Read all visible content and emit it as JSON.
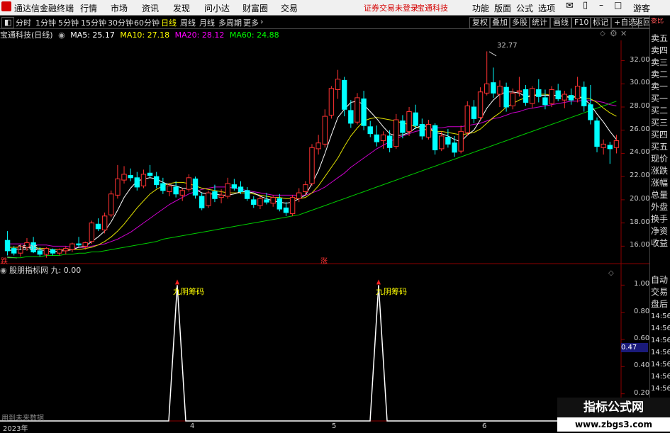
{
  "menubar": {
    "app_title": "通达信金融终端",
    "menus": [
      "行情",
      "市场",
      "资讯",
      "发现",
      "问小达",
      "财富圈",
      "交易"
    ],
    "status_login": "证券交易未登录",
    "status_stock": "宝通科技",
    "right_menus": [
      "功能",
      "版面",
      "公式",
      "选项"
    ],
    "guest": "游客"
  },
  "toolbar": {
    "periods": [
      "分时",
      "1分钟",
      "5分钟",
      "15分钟",
      "30分钟",
      "60分钟",
      "日线",
      "周线",
      "月线",
      "多周期",
      "更多"
    ],
    "active_period": "日线",
    "right_buttons": [
      "复权",
      "叠加",
      "多股",
      "统计",
      "画线",
      "F10",
      "标记",
      "+自选",
      "返回"
    ]
  },
  "chart_header": {
    "stock_title": "宝通科技(日线)",
    "ma5": "MA5: 25.17",
    "ma10": "MA10: 27.18",
    "ma20": "MA20: 28.12",
    "ma60": "MA60: 24.88",
    "colors": {
      "ma5": "#ffffff",
      "ma10": "#ffff00",
      "ma20": "#ff00ff",
      "ma60": "#00ff00"
    }
  },
  "price_axis": [
    "32.00",
    "30.00",
    "28.00",
    "26.00",
    "24.00",
    "22.00",
    "20.00",
    "18.00",
    "16.00"
  ],
  "annotations": {
    "high": "32.77",
    "low": "15.05",
    "rise_mark": "涨",
    "fall_mark": "跌"
  },
  "indicator": {
    "name": "股朋指标网",
    "value_label": "九: 0.00",
    "axis": [
      "1.00",
      "0.80",
      "0.60",
      "0.40",
      "0.20"
    ],
    "current_value": "0.47",
    "signal_text": "九阴筹码",
    "footer": "用到未来数据"
  },
  "time_axis": [
    "2023年",
    "4",
    "5",
    "6"
  ],
  "side_panel": {
    "top": "委比",
    "items": [
      "卖五",
      "卖四",
      "卖三",
      "卖二",
      "卖一",
      "买一",
      "买二",
      "买三",
      "买四",
      "买五",
      "现价",
      "涨跌",
      "涨幅",
      "总量",
      "外盘",
      "换手",
      "净资",
      "收益"
    ],
    "lower": [
      "自动",
      "交易",
      "盘后",
      "14:56",
      "14:56",
      "14:56",
      "14:56",
      "14:56",
      "14:56",
      "14:56",
      "14:56"
    ]
  },
  "watermark": {
    "line1": "指标公式网",
    "line2": "www.zbgs3.com"
  },
  "chart_data": {
    "type": "candlestick",
    "ylim": [
      14.8,
      33.5
    ],
    "candles": [
      [
        16.5,
        17.3,
        15.2,
        15.6
      ],
      [
        15.8,
        16.0,
        15.2,
        15.4
      ],
      [
        15.4,
        16.2,
        15.1,
        16.0
      ],
      [
        15.9,
        16.7,
        15.6,
        16.3
      ],
      [
        16.3,
        16.8,
        15.4,
        15.5
      ],
      [
        15.6,
        15.9,
        15.1,
        15.3
      ],
      [
        15.3,
        15.9,
        15.0,
        15.8
      ],
      [
        15.7,
        15.8,
        15.2,
        15.4
      ],
      [
        15.4,
        15.8,
        15.2,
        15.7
      ],
      [
        15.6,
        16.0,
        15.3,
        15.8
      ],
      [
        15.7,
        16.3,
        15.5,
        16.2
      ],
      [
        16.2,
        16.8,
        15.9,
        16.1
      ],
      [
        16.0,
        16.4,
        15.7,
        16.3
      ],
      [
        16.4,
        18.2,
        16.2,
        18.0
      ],
      [
        17.9,
        18.4,
        17.3,
        17.5
      ],
      [
        17.4,
        18.9,
        17.1,
        18.6
      ],
      [
        18.7,
        20.8,
        18.5,
        20.5
      ],
      [
        20.4,
        23.0,
        20.1,
        21.8
      ],
      [
        21.7,
        22.9,
        21.4,
        22.2
      ],
      [
        22.1,
        22.7,
        21.6,
        21.9
      ],
      [
        21.9,
        22.4,
        20.8,
        21.1
      ],
      [
        21.2,
        22.6,
        21.0,
        22.2
      ],
      [
        22.3,
        23.0,
        21.9,
        22.1
      ],
      [
        22.0,
        22.4,
        21.0,
        21.3
      ],
      [
        21.4,
        21.9,
        20.5,
        20.8
      ],
      [
        20.7,
        21.4,
        20.3,
        21.2
      ],
      [
        21.1,
        21.6,
        20.2,
        20.5
      ],
      [
        20.4,
        21.0,
        19.9,
        20.8
      ],
      [
        20.9,
        22.2,
        20.7,
        21.9
      ],
      [
        21.8,
        22.0,
        20.1,
        20.4
      ],
      [
        20.3,
        20.6,
        19.1,
        19.3
      ],
      [
        19.5,
        20.8,
        19.3,
        20.6
      ],
      [
        20.7,
        21.3,
        19.8,
        20.1
      ],
      [
        20.2,
        20.9,
        19.7,
        20.4
      ],
      [
        20.3,
        21.9,
        20.1,
        21.4
      ],
      [
        21.3,
        21.8,
        20.8,
        21.0
      ],
      [
        21.1,
        21.6,
        20.5,
        20.7
      ],
      [
        20.8,
        21.1,
        19.9,
        20.1
      ],
      [
        20.0,
        20.3,
        19.3,
        19.6
      ],
      [
        19.5,
        20.4,
        19.2,
        20.1
      ],
      [
        20.0,
        20.6,
        19.6,
        19.8
      ],
      [
        19.7,
        20.4,
        19.4,
        20.2
      ],
      [
        20.1,
        20.5,
        19.0,
        19.2
      ],
      [
        19.3,
        19.8,
        18.6,
        18.9
      ],
      [
        18.8,
        20.4,
        18.6,
        20.2
      ],
      [
        20.1,
        21.0,
        19.8,
        20.6
      ],
      [
        20.7,
        21.6,
        20.4,
        21.3
      ],
      [
        21.4,
        24.8,
        21.2,
        24.5
      ],
      [
        24.4,
        25.6,
        23.9,
        24.9
      ],
      [
        24.8,
        27.8,
        24.5,
        27.2
      ],
      [
        27.3,
        29.8,
        27.0,
        29.6
      ],
      [
        29.5,
        31.2,
        28.7,
        30.4
      ],
      [
        30.3,
        30.6,
        27.2,
        27.8
      ],
      [
        27.7,
        28.6,
        26.2,
        26.6
      ],
      [
        26.7,
        29.2,
        26.5,
        28.8
      ],
      [
        28.7,
        29.4,
        26.0,
        26.4
      ],
      [
        26.3,
        26.8,
        25.4,
        25.7
      ],
      [
        25.6,
        26.4,
        24.6,
        25.0
      ],
      [
        25.1,
        25.9,
        24.4,
        25.6
      ],
      [
        25.5,
        26.0,
        24.1,
        24.5
      ],
      [
        24.6,
        27.4,
        24.4,
        26.9
      ],
      [
        26.8,
        27.3,
        25.3,
        25.8
      ],
      [
        25.9,
        28.0,
        25.5,
        27.6
      ],
      [
        27.5,
        28.2,
        26.1,
        26.4
      ],
      [
        26.5,
        27.0,
        25.2,
        25.5
      ],
      [
        25.4,
        26.9,
        25.2,
        26.5
      ],
      [
        26.4,
        26.6,
        23.9,
        24.3
      ],
      [
        24.4,
        25.9,
        24.2,
        25.5
      ],
      [
        25.4,
        26.1,
        24.5,
        24.8
      ],
      [
        24.9,
        25.5,
        23.7,
        24.1
      ],
      [
        24.2,
        26.4,
        24.0,
        25.9
      ],
      [
        25.8,
        28.5,
        25.5,
        28.1
      ],
      [
        28.0,
        28.6,
        26.6,
        27.0
      ],
      [
        27.1,
        29.7,
        26.9,
        29.3
      ],
      [
        29.2,
        32.8,
        29.0,
        30.0
      ],
      [
        30.1,
        31.4,
        28.8,
        29.2
      ],
      [
        29.1,
        30.3,
        28.0,
        29.8
      ],
      [
        29.7,
        30.1,
        27.6,
        28.0
      ],
      [
        28.1,
        29.6,
        27.8,
        29.2
      ],
      [
        29.3,
        30.6,
        28.9,
        29.4
      ],
      [
        29.5,
        29.9,
        28.1,
        28.4
      ],
      [
        28.3,
        29.8,
        27.9,
        29.6
      ],
      [
        29.5,
        30.4,
        28.4,
        28.9
      ],
      [
        28.8,
        29.5,
        27.8,
        28.2
      ],
      [
        28.3,
        29.8,
        28.0,
        29.5
      ],
      [
        29.4,
        30.0,
        28.5,
        28.7
      ],
      [
        28.6,
        29.4,
        27.9,
        29.1
      ],
      [
        29.0,
        29.6,
        28.2,
        28.6
      ],
      [
        28.7,
        30.6,
        28.4,
        29.8
      ],
      [
        29.7,
        30.2,
        27.6,
        28.1
      ],
      [
        28.2,
        29.9,
        26.5,
        26.9
      ],
      [
        26.8,
        27.1,
        24.1,
        24.6
      ],
      [
        24.5,
        25.2,
        23.9,
        24.8
      ],
      [
        24.7,
        25.0,
        23.1,
        24.4
      ],
      [
        24.5,
        25.6,
        24.0,
        25.1
      ]
    ],
    "ma5": [
      15.6,
      15.7,
      15.8,
      15.9,
      15.8,
      15.7,
      15.6,
      15.5,
      15.6,
      15.6,
      15.7,
      15.9,
      16.0,
      16.4,
      16.8,
      17.3,
      18.1,
      19.1,
      20.2,
      21.0,
      21.6,
      21.8,
      21.9,
      21.8,
      21.5,
      21.3,
      21.2,
      21.0,
      21.0,
      20.9,
      20.6,
      20.5,
      20.5,
      20.4,
      20.4,
      20.5,
      20.7,
      20.7,
      20.6,
      20.3,
      20.1,
      19.9,
      19.8,
      19.7,
      19.8,
      20.1,
      20.4,
      21.4,
      22.5,
      24.0,
      25.6,
      27.1,
      27.8,
      28.4,
      28.5,
      28.2,
      27.6,
      27.0,
      26.3,
      25.7,
      25.5,
      25.6,
      25.8,
      26.2,
      26.4,
      26.3,
      25.8,
      25.7,
      25.5,
      25.2,
      25.0,
      25.6,
      26.0,
      26.9,
      27.9,
      28.6,
      29.1,
      29.3,
      29.3,
      29.2,
      28.9,
      29.0,
      29.0,
      29.0,
      29.0,
      29.0,
      28.9,
      28.8,
      28.9,
      28.7,
      28.2,
      27.4,
      26.7,
      25.9,
      25.2
    ],
    "ma10": [
      15.9,
      15.9,
      15.9,
      15.9,
      15.9,
      15.8,
      15.8,
      15.7,
      15.7,
      15.7,
      15.7,
      15.7,
      15.8,
      15.9,
      16.1,
      16.4,
      16.8,
      17.3,
      17.9,
      18.6,
      19.3,
      19.9,
      20.5,
      20.9,
      21.2,
      21.4,
      21.5,
      21.5,
      21.4,
      21.2,
      21.0,
      20.9,
      20.8,
      20.7,
      20.6,
      20.6,
      20.6,
      20.6,
      20.5,
      20.4,
      20.3,
      20.2,
      20.2,
      20.1,
      20.1,
      20.1,
      20.2,
      20.6,
      21.2,
      22.0,
      22.8,
      23.6,
      24.6,
      25.5,
      26.2,
      26.8,
      27.0,
      27.1,
      27.0,
      26.9,
      26.8,
      26.6,
      26.5,
      26.3,
      26.1,
      26.0,
      25.9,
      25.9,
      25.8,
      25.7,
      25.6,
      25.7,
      25.8,
      26.1,
      26.6,
      27.1,
      27.5,
      28.0,
      28.3,
      28.6,
      28.8,
      29.0,
      29.1,
      29.1,
      29.0,
      29.0,
      28.9,
      28.9,
      28.9,
      28.8,
      28.7,
      28.4,
      27.9,
      27.5,
      27.2
    ],
    "ma20": [
      16.2,
      16.2,
      16.2,
      16.2,
      16.1,
      16.1,
      16.1,
      16.0,
      16.0,
      16.0,
      15.9,
      15.9,
      15.9,
      16.0,
      16.1,
      16.2,
      16.4,
      16.6,
      16.9,
      17.2,
      17.6,
      18.0,
      18.4,
      18.8,
      19.2,
      19.6,
      19.9,
      20.2,
      20.5,
      20.7,
      20.9,
      21.0,
      21.1,
      21.1,
      21.1,
      21.0,
      20.9,
      20.8,
      20.7,
      20.6,
      20.5,
      20.4,
      20.4,
      20.4,
      20.4,
      20.4,
      20.4,
      20.6,
      20.8,
      21.1,
      21.5,
      21.9,
      22.3,
      22.8,
      23.2,
      23.6,
      24.0,
      24.4,
      24.7,
      25.0,
      25.3,
      25.5,
      25.7,
      25.9,
      26.0,
      26.1,
      26.2,
      26.2,
      26.3,
      26.3,
      26.3,
      26.4,
      26.5,
      26.6,
      26.8,
      27.0,
      27.1,
      27.3,
      27.5,
      27.6,
      27.8,
      27.9,
      28.0,
      28.1,
      28.2,
      28.3,
      28.4,
      28.5,
      28.5,
      28.6,
      28.6,
      28.5,
      28.4,
      28.2,
      28.1
    ],
    "ma60": [
      15.0,
      15.0,
      15.0,
      15.1,
      15.1,
      15.1,
      15.2,
      15.2,
      15.2,
      15.3,
      15.3,
      15.4,
      15.4,
      15.5,
      15.5,
      15.6,
      15.7,
      15.8,
      15.9,
      16.0,
      16.1,
      16.2,
      16.3,
      16.4,
      16.6,
      16.7,
      16.8,
      16.9,
      17.0,
      17.1,
      17.2,
      17.3,
      17.4,
      17.5,
      17.6,
      17.7,
      17.8,
      17.9,
      18.0,
      18.1,
      18.2,
      18.3,
      18.4,
      18.5,
      18.6,
      18.7,
      18.9,
      19.1,
      19.3,
      19.5,
      19.7,
      19.9,
      20.1,
      20.3,
      20.5,
      20.7,
      20.9,
      21.1,
      21.3,
      21.5,
      21.7,
      21.9,
      22.1,
      22.3,
      22.5,
      22.7,
      22.9,
      23.1,
      23.3,
      23.5,
      23.7,
      23.9,
      24.1,
      24.3,
      24.5,
      24.7,
      24.9,
      25.1,
      25.3,
      25.5,
      25.7,
      25.9,
      26.1,
      26.3,
      26.5,
      26.7,
      26.9,
      27.1,
      27.3,
      27.5,
      27.7,
      27.9,
      28.1,
      28.3,
      28.5
    ],
    "signal_indices": [
      42,
      91
    ],
    "indicator_ylim": [
      0,
      1.08
    ]
  }
}
